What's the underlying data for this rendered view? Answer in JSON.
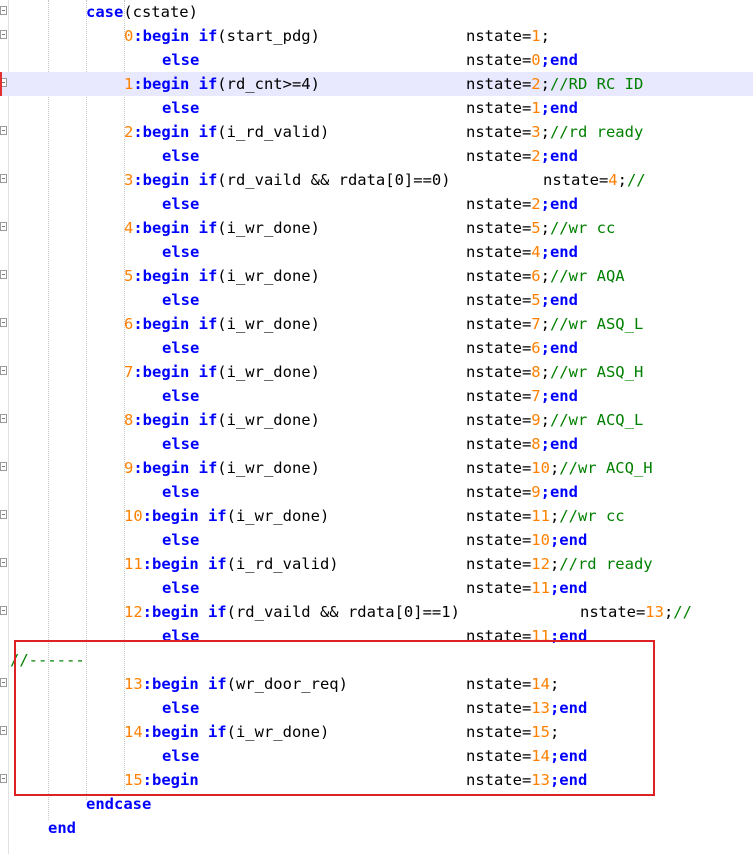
{
  "editor": {
    "header": {
      "case_kw": "case",
      "case_expr": "(cstate)"
    },
    "rows": [
      {
        "label": "0",
        "cond_kw": "if",
        "cond": "(start_pdg)",
        "else": "else",
        "then_state": "nstate=",
        "then_val": "1",
        "then_end": ";",
        "then_comment": "",
        "else_state": "nstate=",
        "else_val": "0",
        "else_end": ";end"
      },
      {
        "label": "1",
        "cond_kw": "if",
        "cond": "(rd_cnt>=4)",
        "else": "else",
        "then_state": "nstate=",
        "then_val": "2",
        "then_end": ";",
        "then_comment": "//RD RC ID",
        "else_state": "nstate=",
        "else_val": "1",
        "else_end": ";end"
      },
      {
        "label": "2",
        "cond_kw": "if",
        "cond": "(i_rd_valid)",
        "else": "else",
        "then_state": "nstate=",
        "then_val": "3",
        "then_end": ";",
        "then_comment": "//rd ready",
        "else_state": "nstate=",
        "else_val": "2",
        "else_end": ";end"
      },
      {
        "label": "3",
        "cond_kw": "if",
        "cond": "(rd_vaild && rdata[0]==0)",
        "else": "else",
        "then_state": "nstate=",
        "then_val": "4",
        "then_end": ";",
        "then_comment": "//",
        "else_state": "nstate=",
        "else_val": "2",
        "else_end": ";end"
      },
      {
        "label": "4",
        "cond_kw": "if",
        "cond": "(i_wr_done)",
        "else": "else",
        "then_state": "nstate=",
        "then_val": "5",
        "then_end": ";",
        "then_comment": "//wr cc",
        "else_state": "nstate=",
        "else_val": "4",
        "else_end": ";end"
      },
      {
        "label": "5",
        "cond_kw": "if",
        "cond": "(i_wr_done)",
        "else": "else",
        "then_state": "nstate=",
        "then_val": "6",
        "then_end": ";",
        "then_comment": "//wr AQA",
        "else_state": "nstate=",
        "else_val": "5",
        "else_end": ";end"
      },
      {
        "label": "6",
        "cond_kw": "if",
        "cond": "(i_wr_done)",
        "else": "else",
        "then_state": "nstate=",
        "then_val": "7",
        "then_end": ";",
        "then_comment": "//wr ASQ_L",
        "else_state": "nstate=",
        "else_val": "6",
        "else_end": ";end"
      },
      {
        "label": "7",
        "cond_kw": "if",
        "cond": "(i_wr_done)",
        "else": "else",
        "then_state": "nstate=",
        "then_val": "8",
        "then_end": ";",
        "then_comment": "//wr ASQ_H",
        "else_state": "nstate=",
        "else_val": "7",
        "else_end": ";end"
      },
      {
        "label": "8",
        "cond_kw": "if",
        "cond": "(i_wr_done)",
        "else": "else",
        "then_state": "nstate=",
        "then_val": "9",
        "then_end": ";",
        "then_comment": "//wr ACQ_L",
        "else_state": "nstate=",
        "else_val": "8",
        "else_end": ";end"
      },
      {
        "label": "9",
        "cond_kw": "if",
        "cond": "(i_wr_done)",
        "else": "else",
        "then_state": "nstate=",
        "then_val": "10",
        "then_end": ";",
        "then_comment": "//wr ACQ_H",
        "else_state": "nstate=",
        "else_val": "9",
        "else_end": ";end"
      },
      {
        "label": "10",
        "cond_kw": "if",
        "cond": "(i_wr_done)",
        "else": "else",
        "then_state": "nstate=",
        "then_val": "11",
        "then_end": ";",
        "then_comment": "//wr cc",
        "else_state": "nstate=",
        "else_val": "10",
        "else_end": ";end"
      },
      {
        "label": "11",
        "cond_kw": "if",
        "cond": "(i_rd_valid)",
        "else": "else",
        "then_state": "nstate=",
        "then_val": "12",
        "then_end": ";",
        "then_comment": "//rd ready",
        "else_state": "nstate=",
        "else_val": "11",
        "else_end": ";end"
      },
      {
        "label": "12",
        "cond_kw": "if",
        "cond": "(rd_vaild && rdata[0]==1)",
        "else": "else",
        "then_state": "nstate=",
        "then_val": "13",
        "then_end": ";",
        "then_comment": "//",
        "else_state": "nstate=",
        "else_val": "11",
        "else_end": ";end"
      }
    ],
    "divider_comment": "//------",
    "boxed_rows": [
      {
        "label": "13",
        "cond_kw": "if",
        "cond": "(wr_door_req)",
        "then_state": "nstate=",
        "then_val": "14",
        "then_end": ";",
        "else": "else",
        "else_state": "nstate=",
        "else_val": "13",
        "else_end": ";end"
      },
      {
        "label": "14",
        "cond_kw": "if",
        "cond": "(i_wr_done)",
        "then_state": "nstate=",
        "then_val": "15",
        "then_end": ";",
        "else": "else",
        "else_state": "nstate=",
        "else_val": "14",
        "else_end": ";end"
      },
      {
        "label": "15",
        "cond_kw": "",
        "cond": "",
        "then_state": "nstate=",
        "then_val": "13",
        "then_end": ";end"
      }
    ],
    "colon_begin": ":begin",
    "footer": {
      "endcase": "endcase",
      "end": "end"
    }
  },
  "colors": {
    "keyword": "#0000ff",
    "number": "#ff8000",
    "comment": "#008000",
    "highlight": "#e8e8ff",
    "box": "#dd2222"
  },
  "icons": {
    "fold": "fold-toggle-icon"
  }
}
